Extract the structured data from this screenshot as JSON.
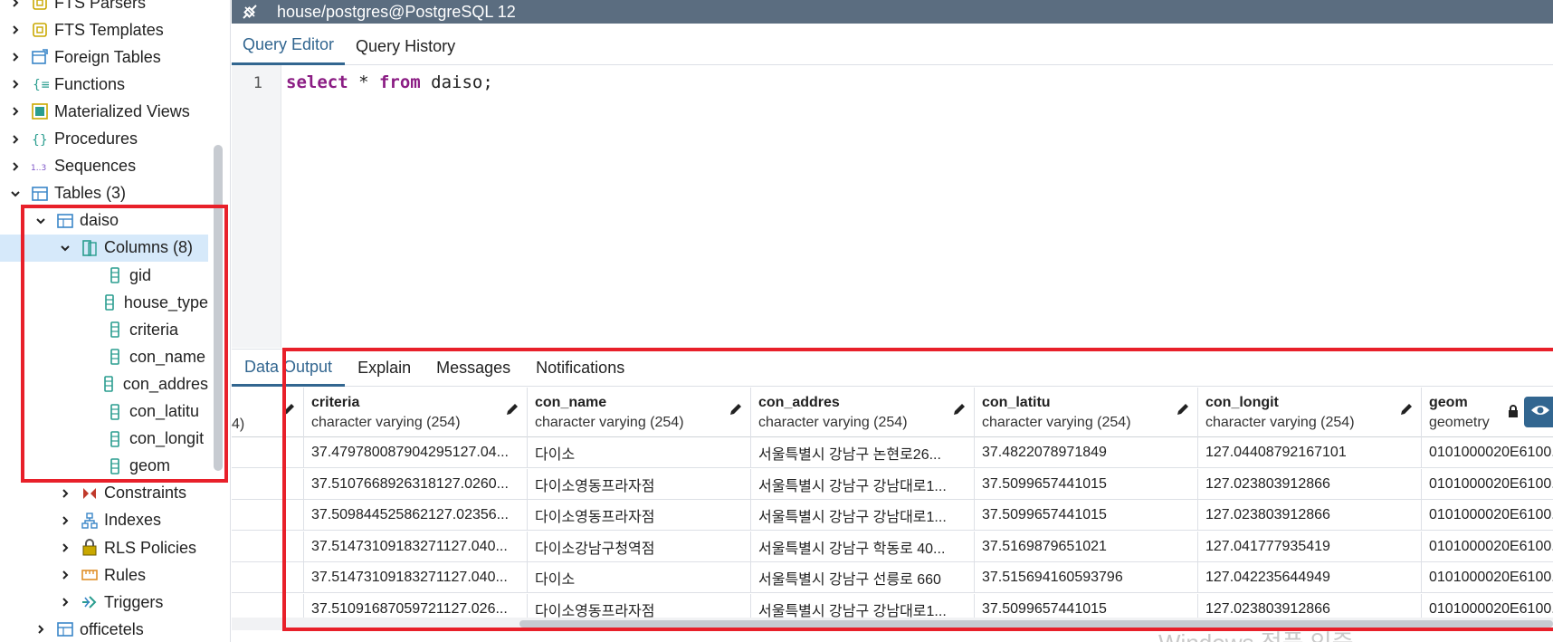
{
  "sidebar": {
    "items": [
      {
        "label": "FTS Parsers",
        "icon": "fts-parser-icon",
        "level": 1,
        "expander": "collapsed"
      },
      {
        "label": "FTS Templates",
        "icon": "fts-template-icon",
        "level": 1,
        "expander": "collapsed"
      },
      {
        "label": "Foreign Tables",
        "icon": "foreign-table-icon",
        "level": 1,
        "expander": "collapsed"
      },
      {
        "label": "Functions",
        "icon": "function-icon",
        "level": 1,
        "expander": "collapsed"
      },
      {
        "label": "Materialized Views",
        "icon": "materialized-view-icon",
        "level": 1,
        "expander": "collapsed"
      },
      {
        "label": "Procedures",
        "icon": "procedure-icon",
        "level": 1,
        "expander": "collapsed"
      },
      {
        "label": "Sequences",
        "icon": "sequence-icon",
        "level": 1,
        "expander": "collapsed"
      },
      {
        "label": "Tables (3)",
        "icon": "tables-icon",
        "level": 1,
        "expander": "expanded"
      },
      {
        "label": "daiso",
        "icon": "table-icon",
        "level": 2,
        "expander": "expanded"
      },
      {
        "label": "Columns (8)",
        "icon": "columns-icon",
        "level": 3,
        "expander": "expanded",
        "selected": true
      },
      {
        "label": "gid",
        "icon": "column-icon",
        "level": 4,
        "expander": "none"
      },
      {
        "label": "house_type",
        "icon": "column-icon",
        "level": 4,
        "expander": "none"
      },
      {
        "label": "criteria",
        "icon": "column-icon",
        "level": 4,
        "expander": "none"
      },
      {
        "label": "con_name",
        "icon": "column-icon",
        "level": 4,
        "expander": "none"
      },
      {
        "label": "con_addres",
        "icon": "column-icon",
        "level": 4,
        "expander": "none"
      },
      {
        "label": "con_latitu",
        "icon": "column-icon",
        "level": 4,
        "expander": "none"
      },
      {
        "label": "con_longit",
        "icon": "column-icon",
        "level": 4,
        "expander": "none"
      },
      {
        "label": "geom",
        "icon": "column-icon",
        "level": 4,
        "expander": "none"
      },
      {
        "label": "Constraints",
        "icon": "constraints-icon",
        "level": 3,
        "expander": "collapsed"
      },
      {
        "label": "Indexes",
        "icon": "indexes-icon",
        "level": 3,
        "expander": "collapsed"
      },
      {
        "label": "RLS Policies",
        "icon": "rls-policy-icon",
        "level": 3,
        "expander": "collapsed"
      },
      {
        "label": "Rules",
        "icon": "rules-icon",
        "level": 3,
        "expander": "collapsed"
      },
      {
        "label": "Triggers",
        "icon": "triggers-icon",
        "level": 3,
        "expander": "collapsed"
      },
      {
        "label": "officetels",
        "icon": "table-icon",
        "level": 2,
        "expander": "collapsed"
      }
    ]
  },
  "topbar": {
    "connection_title": "house/postgres@PostgreSQL 12",
    "icon": "connection-plug-icon"
  },
  "editor_tabs": [
    "Query Editor",
    "Query History"
  ],
  "editor": {
    "line_number": "1",
    "code_keyword1": "select",
    "code_op": " * ",
    "code_keyword2": "from",
    "code_rest": " daiso;"
  },
  "output_tabs": [
    "Data Output",
    "Explain",
    "Messages",
    "Notifications"
  ],
  "grid": {
    "partial_col_header": "4)",
    "columns": [
      {
        "name": "criteria",
        "type": "character varying (254)"
      },
      {
        "name": "con_name",
        "type": "character varying (254)"
      },
      {
        "name": "con_addres",
        "type": "character varying (254)"
      },
      {
        "name": "con_latitu",
        "type": "character varying (254)"
      },
      {
        "name": "con_longit",
        "type": "character varying (254)"
      },
      {
        "name": "geom",
        "type": "geometry"
      }
    ],
    "rows": [
      [
        "37.479780087904295127.04...",
        "다이소",
        "서울특별시 강남구 논현로26...",
        "37.4822078971849",
        "127.04408792167101",
        "0101000020E6100..."
      ],
      [
        "37.5107668926318127.0260...",
        "다이소영동프라자점",
        "서울특별시 강남구 강남대로1...",
        "37.5099657441015",
        "127.023803912866",
        "0101000020E6100..."
      ],
      [
        "37.509844525862127.02356...",
        "다이소영동프라자점",
        "서울특별시 강남구 강남대로1...",
        "37.5099657441015",
        "127.023803912866",
        "0101000020E6100..."
      ],
      [
        "37.51473109183271127.040...",
        "다이소강남구청역점",
        "서울특별시 강남구 학동로 40...",
        "37.5169879651021",
        "127.041777935419",
        "0101000020E6100..."
      ],
      [
        "37.51473109183271127.040...",
        "다이소",
        "서울특별시 강남구 선릉로 660",
        "37.515694160593796",
        "127.042235644949",
        "0101000020E6100..."
      ],
      [
        "37.51091687059721127.026...",
        "다이소영동프라자점",
        "서울특별시 강남구 강남대로1...",
        "37.5099657441015",
        "127.023803912866",
        "0101000020E6100..."
      ]
    ]
  },
  "watermark": "Windows 정품 인증",
  "colors": {
    "accent": "#326690",
    "topbar": "#5b6d80",
    "highlight": "#e8202a",
    "selected_row": "#d6e9fa",
    "keyword": "#8b1d84"
  }
}
